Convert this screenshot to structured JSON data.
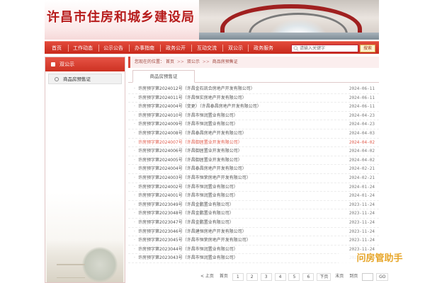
{
  "header": {
    "site_title": "许昌市住房和城乡建设局"
  },
  "nav": {
    "items": [
      "首页",
      "工作动态",
      "公示公告",
      "办事指南",
      "政务公开",
      "互动交流",
      "双公示",
      "政务服务"
    ],
    "search_placeholder": "请输入关键字",
    "search_button": "搜索"
  },
  "sidebar": {
    "title": "双公示",
    "items": [
      {
        "label": "商品房预售证"
      }
    ]
  },
  "breadcrumb": {
    "prefix": "您现在的位置：",
    "items": [
      "首页",
      "双公示",
      "商品房预售证"
    ],
    "separator": ">>"
  },
  "tab": {
    "label": "商品房预售证"
  },
  "list": [
    {
      "title": "许房预字第2024012号（许昌金石凯合房地产开发有限公司）",
      "date": "2024-06-11"
    },
    {
      "title": "许房预字第2024011号（许昌恒实房地产开发有限公司）",
      "date": "2024-06-11"
    },
    {
      "title": "许房预字第2024004号（变更）（许昌泰昌房地产开发有限公司）",
      "date": "2024-06-11"
    },
    {
      "title": "许房预字第2024010号（许昌市恒润置业有限公司）",
      "date": "2024-04-23"
    },
    {
      "title": "许房预字第2024009号（许昌市恒润置业有限公司）",
      "date": "2024-04-23"
    },
    {
      "title": "许房预字第2024008号（许昌泰昌房地产开发有限公司）",
      "date": "2024-04-03"
    },
    {
      "title": "许房预字第2024007号（许昌御居置业开发有限公司）",
      "date": "2024-04-02",
      "highlight": true
    },
    {
      "title": "许房预字第2024006号（许昌御居置业开发有限公司）",
      "date": "2024-04-02"
    },
    {
      "title": "许房预字第2024005号（许昌御居置业开发有限公司）",
      "date": "2024-04-02"
    },
    {
      "title": "许房预字第2024004号（许昌泰昌房地产开发有限公司）",
      "date": "2024-02-21"
    },
    {
      "title": "许房预字第2024003号（许昌市恒荣房地产开发有限公司）",
      "date": "2024-02-21"
    },
    {
      "title": "许房预字第2024002号（许昌市恒润置业有限公司）",
      "date": "2024-01-24"
    },
    {
      "title": "许房预字第2024001号（许昌市恒润置业有限公司）",
      "date": "2024-01-24"
    },
    {
      "title": "许房预字第2023049号（许昌金鹏置业有限公司）",
      "date": "2023-11-24"
    },
    {
      "title": "许房预字第2023048号（许昌金鹏置业有限公司）",
      "date": "2023-11-24"
    },
    {
      "title": "许房预字第2023047号（许昌金鹏置业有限公司）",
      "date": "2023-11-24"
    },
    {
      "title": "许房预字第2023046号（许昌建恒房地产开发有限公司）",
      "date": "2023-11-24"
    },
    {
      "title": "许房预字第2023045号（许昌市恒荣房地产开发有限公司）",
      "date": "2023-11-24"
    },
    {
      "title": "许房预字第2023044号（许昌市恒润置业有限公司）",
      "date": "2023-11-24"
    },
    {
      "title": "许房预字第2023043号（许昌市恒润置业有限公司）",
      "date": "2023-11-24"
    }
  ],
  "pager": {
    "prev": "< 上页",
    "first": "首页",
    "pages": [
      "1",
      "2",
      "3",
      "4",
      "5",
      "6"
    ],
    "next": "下页",
    "last": "末页",
    "goto": "到页",
    "go_button": "GO"
  },
  "watermark": {
    "text": "问房管助手"
  }
}
